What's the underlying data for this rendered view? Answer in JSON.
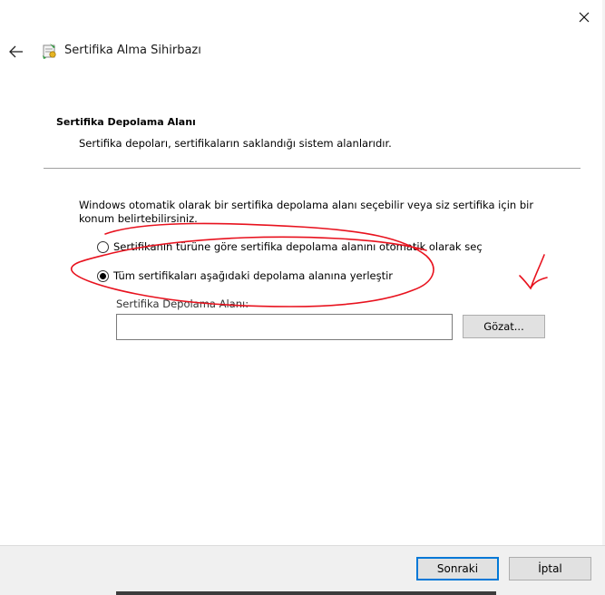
{
  "window": {
    "close_icon": "close-icon",
    "back_icon": "back-arrow-icon"
  },
  "header": {
    "title": "Sertifika Alma Sihirbazı",
    "icon": "certificate-wizard-icon"
  },
  "section": {
    "title": "Sertifika Depolama Alanı",
    "description": "Sertifika depoları, sertifikaların saklandığı sistem alanlarıdır."
  },
  "info_text": "Windows otomatik olarak bir sertifika depolama alanı seçebilir veya siz sertifika için bir konum belirtebilirsiniz.",
  "options": [
    {
      "label": "Sertifikanın türüne göre sertifika depolama alanını otomatik olarak seç",
      "selected": false
    },
    {
      "label": "Tüm sertifikaları aşağıdaki depolama alanına yerleştir",
      "selected": true
    }
  ],
  "store": {
    "label": "Sertifika Depolama Alanı:",
    "value": "",
    "browse_label": "Gözat..."
  },
  "footer": {
    "next_label": "Sonraki",
    "cancel_label": "İptal"
  },
  "colors": {
    "annotation_red": "#e8121e",
    "focus_blue": "#0078d7",
    "button_face": "#e1e1e1",
    "footer_bg": "#f0f0f0"
  }
}
